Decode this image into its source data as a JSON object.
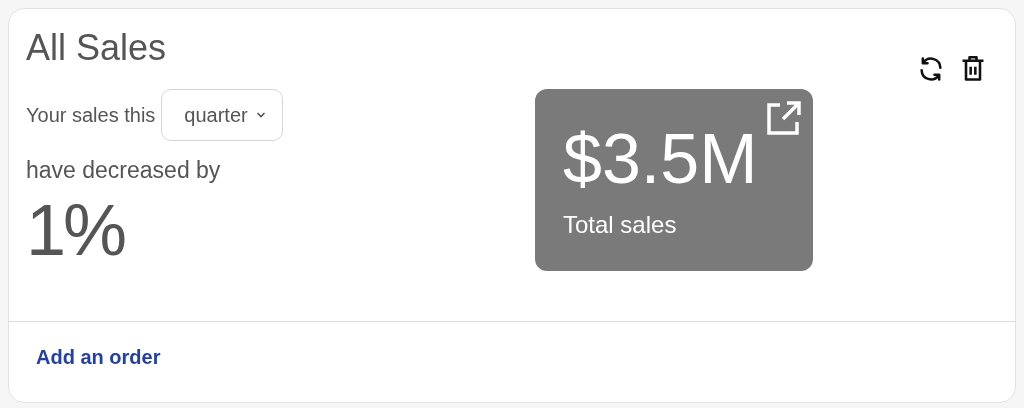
{
  "card": {
    "title": "All Sales"
  },
  "summary": {
    "lead": "Your sales this",
    "period": "quarter",
    "trend": "have decreased by",
    "change": "1%"
  },
  "stat_tile": {
    "value": "$3.5M",
    "label": "Total sales"
  },
  "footer": {
    "link": "Add an order"
  }
}
